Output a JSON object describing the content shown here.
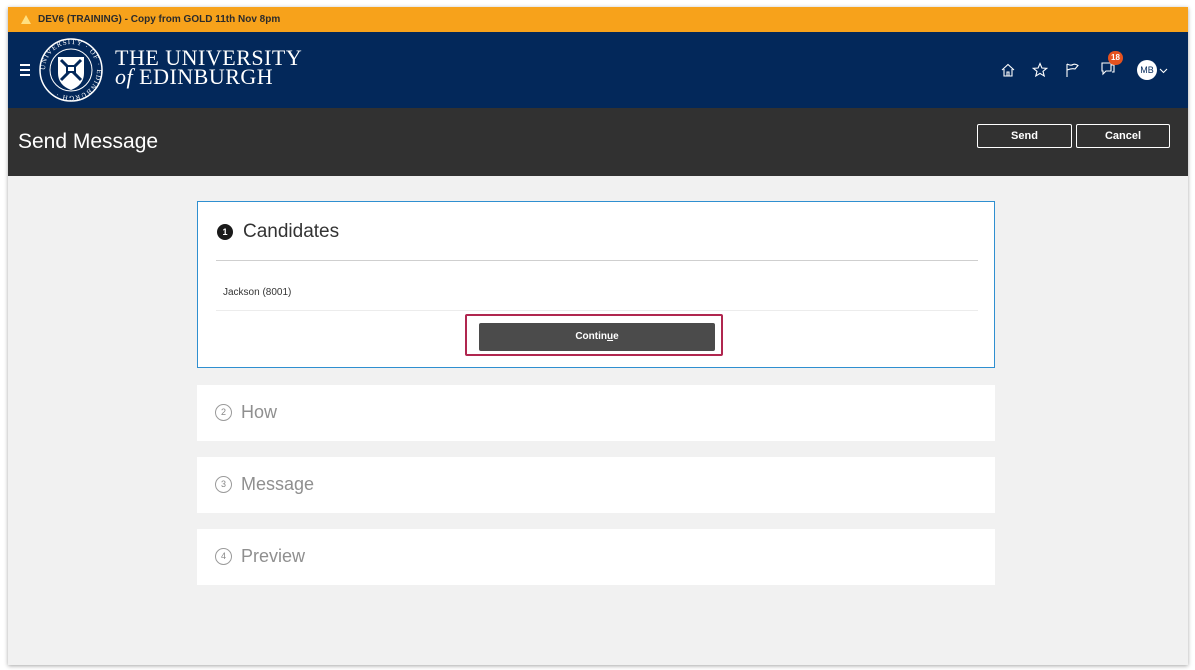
{
  "banner": {
    "text": "DEV6 (TRAINING) - Copy from GOLD 11th Nov 8pm",
    "color": "#f7a21b"
  },
  "header": {
    "brand_line1": "THE UNIVERSITY",
    "brand_line2_of": "of",
    "brand_line2_name": "EDINBURGH",
    "crest_text": "UNIVERSITY OF EDINBURGH",
    "background": "#03285a",
    "notification_count": "18",
    "avatar_initials": "MB",
    "icons": [
      "home-icon",
      "star-icon",
      "flag-icon",
      "notifications-icon"
    ]
  },
  "title_bar": {
    "title": "Send Message",
    "send_label": "Send",
    "cancel_label": "Cancel"
  },
  "steps": [
    {
      "number": "1",
      "title": "Candidates",
      "active": true
    },
    {
      "number": "2",
      "title": "How",
      "active": false
    },
    {
      "number": "3",
      "title": "Message",
      "active": false
    },
    {
      "number": "4",
      "title": "Preview",
      "active": false
    }
  ],
  "candidates": {
    "item": "Jackson (8001)",
    "continue_label_pre": "Contin",
    "continue_label_u": "u",
    "continue_label_post": "e"
  }
}
